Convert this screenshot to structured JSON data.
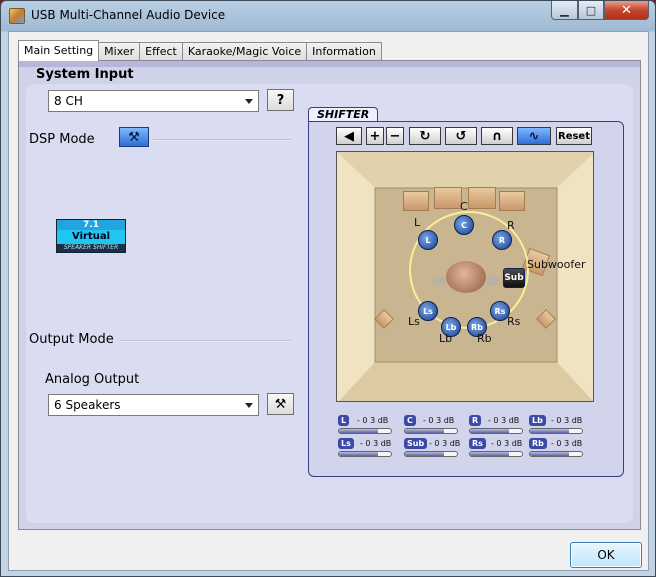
{
  "window": {
    "title": "USB Multi-Channel Audio Device"
  },
  "tabs": [
    {
      "label": "Main Setting",
      "active": true
    },
    {
      "label": "Mixer"
    },
    {
      "label": "Effect"
    },
    {
      "label": "Karaoke/Magic Voice"
    },
    {
      "label": "Information"
    }
  ],
  "system_input": {
    "label": "System Input",
    "value": "8 CH",
    "help_label": "?"
  },
  "dsp_mode": {
    "label": "DSP Mode",
    "badge": {
      "top": "7.1",
      "middle": "Virtual",
      "bottom": "SPEAKER SHIFTER"
    }
  },
  "output_mode": {
    "label": "Output Mode",
    "analog_label": "Analog Output",
    "analog_value": "6 Speakers"
  },
  "shifter": {
    "tab_label": "SHIFTER",
    "reset_label": "Reset",
    "speakers": [
      {
        "id": "L",
        "label": "L"
      },
      {
        "id": "C",
        "label": "C"
      },
      {
        "id": "R",
        "label": "R"
      },
      {
        "id": "Sub",
        "label": "Subwoofer"
      },
      {
        "id": "Ls",
        "label": "Ls"
      },
      {
        "id": "Lb",
        "label": "Lb"
      },
      {
        "id": "Rb",
        "label": "Rb"
      },
      {
        "id": "Rs",
        "label": "Rs"
      }
    ],
    "levels": [
      {
        "ch": "L",
        "db": "- 0 3 dB",
        "level": 0.75
      },
      {
        "ch": "C",
        "db": "- 0 3 dB",
        "level": 0.75
      },
      {
        "ch": "R",
        "db": "- 0 3 dB",
        "level": 0.75
      },
      {
        "ch": "Lb",
        "db": "- 0 3 dB",
        "level": 0.75
      },
      {
        "ch": "Ls",
        "db": "- 0 3 dB",
        "level": 0.75
      },
      {
        "ch": "Sub",
        "db": "- 0 3 dB",
        "level": 0.75
      },
      {
        "ch": "Rs",
        "db": "- 0 3 dB",
        "level": 0.75
      },
      {
        "ch": "Rb",
        "db": "- 0 3 dB",
        "level": 0.75
      }
    ]
  },
  "ok_label": "OK",
  "colors": {
    "accent": "#2e6fd4",
    "panel": "#d0d2ea",
    "speaker": "#173d8f"
  }
}
